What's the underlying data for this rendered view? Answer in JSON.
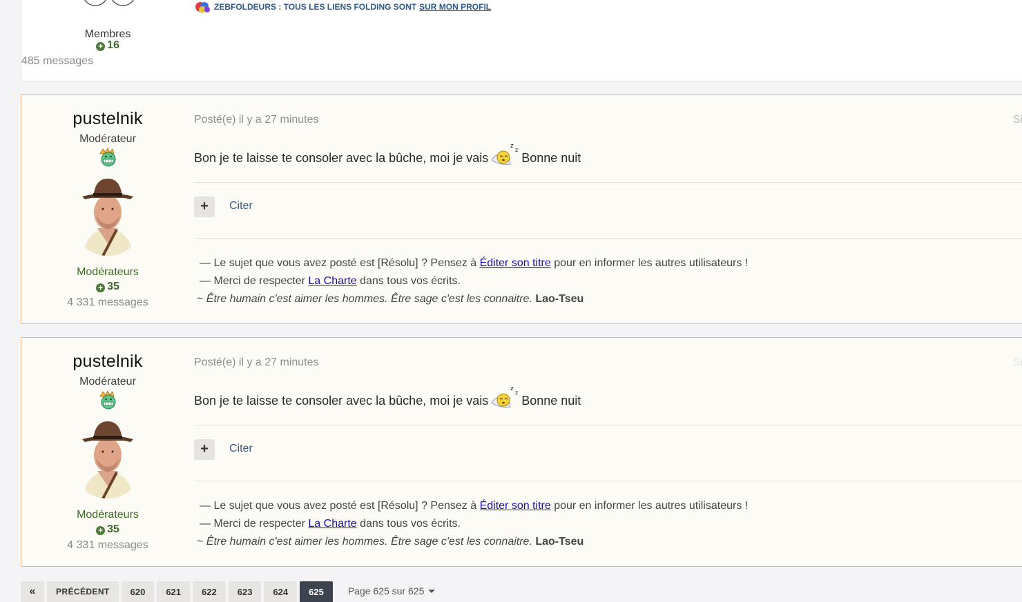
{
  "top_post": {
    "author_group": "Membres",
    "reputation": "16",
    "post_count": "485 messages",
    "signature_text": "ZEBFOLDEURS : TOUS LES LIENS FOLDING SONT",
    "signature_link": "SUR MON PROFIL"
  },
  "posts": [
    {
      "username": "pustelnik",
      "user_title": "Modérateur",
      "group": "Modérateurs",
      "reputation": "35",
      "post_count": "4 331 messages",
      "meta": "Posté(e) il y a 27 minutes",
      "meta_right": "Si",
      "content_before": "Bon je te laisse te consoler avec la bûche, moi je vais",
      "content_after": "Bonne nuit",
      "plus_label": "+",
      "quote_label": "Citer",
      "sig": {
        "line1_a": "— Le sujet que vous avez posté est [Résolu] ? Pensez à",
        "line1_link": "Éditer son titre",
        "line1_b": "pour en informer les autres utilisateurs !",
        "line2_a": "— Merci de respecter",
        "line2_link": "La Charte",
        "line2_b": "dans tous vos écrits.",
        "line3_prefix": "~",
        "line3_quote": "Être humain c'est aimer les hommes. Être sage c'est les connaitre.",
        "line3_author": "Lao-Tseu"
      }
    },
    {
      "username": "pustelnik",
      "user_title": "Modérateur",
      "group": "Modérateurs",
      "reputation": "35",
      "post_count": "4 331 messages",
      "meta": "Posté(e) il y a 27 minutes",
      "meta_right": "Si",
      "content_before": "Bon je te laisse te consoler avec la bûche, moi je vais",
      "content_after": "Bonne nuit",
      "plus_label": "+",
      "quote_label": "Citer",
      "sig": {
        "line1_a": "— Le sujet que vous avez posté est [Résolu] ? Pensez à",
        "line1_link": "Éditer son titre",
        "line1_b": "pour en informer les autres utilisateurs !",
        "line2_a": "— Merci de respecter",
        "line2_link": "La Charte",
        "line2_b": "dans tous vos écrits.",
        "line3_prefix": "~",
        "line3_quote": "Être humain c'est aimer les hommes. Être sage c'est les connaitre.",
        "line3_author": "Lao-Tseu"
      }
    }
  ],
  "pagination": {
    "first_label": "«",
    "prev_label": "PRÉCÉDENT",
    "pages": [
      "620",
      "621",
      "622",
      "623",
      "624",
      "625"
    ],
    "active_page": "625",
    "page_jump_label": "Page 625 sur 625"
  },
  "icons": {
    "rank": "moderator-crown-grin-icon",
    "sleep": "sleeping-smiley-icon",
    "fold": "folding-logo-icon",
    "reputation_plus": "plus-circle-icon"
  },
  "colors": {
    "post_border": "#efb585",
    "post_bg": "#fdfbf6",
    "group_green": "#3b6b24",
    "link_blue": "#1a0dab",
    "active_page": "#3d434e"
  }
}
